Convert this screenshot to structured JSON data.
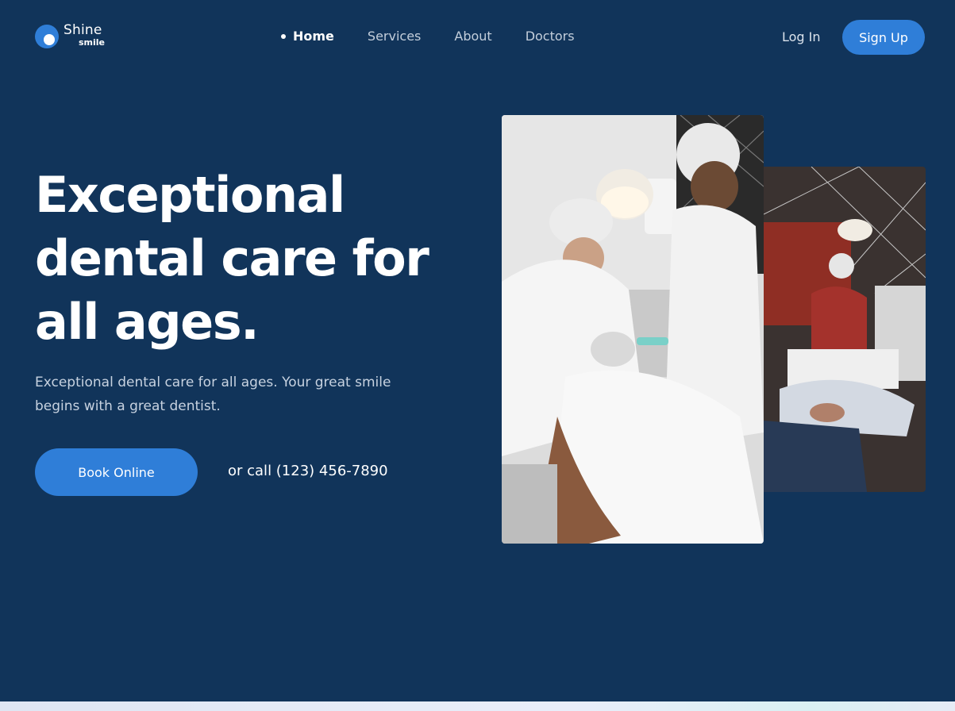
{
  "brand": {
    "name": "Shine",
    "sub": "smile"
  },
  "nav": {
    "items": [
      {
        "label": "Home",
        "active": true
      },
      {
        "label": "Services",
        "active": false
      },
      {
        "label": "About",
        "active": false
      },
      {
        "label": "Doctors",
        "active": false
      }
    ],
    "login_label": "Log In",
    "signup_label": "Sign Up"
  },
  "hero": {
    "title_lines": [
      "Exceptional",
      "dental care for",
      "all ages."
    ],
    "subtitle": "Exceptional dental care for all ages. Your great smile begins with a great dentist.",
    "cta_label": "Book Online",
    "call_text": "or call (123) 456-7890"
  },
  "colors": {
    "background": "#11345a",
    "accent": "#2f7ed8",
    "text": "#ffffff",
    "muted": "#c7d2e0"
  },
  "images": {
    "main": "dentists-treating-patient-photo",
    "side": "dentist-with-patient-red-wall-photo"
  }
}
